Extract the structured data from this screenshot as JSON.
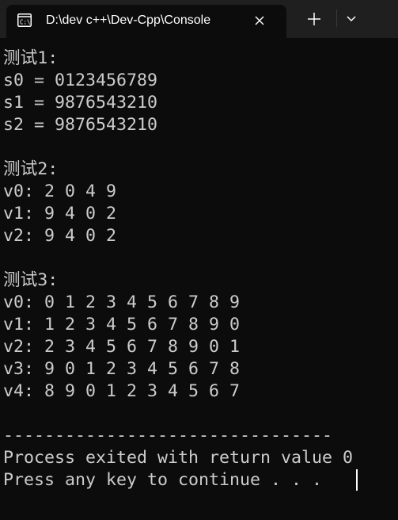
{
  "window": {
    "tab_title": "D:\\dev c++\\Dev-Cpp\\Console",
    "tab_icon": "console-app-icon",
    "close_icon": "close-icon",
    "new_tab_icon": "plus-icon",
    "dropdown_icon": "chevron-down-icon"
  },
  "console": {
    "lines": [
      "测试1:",
      "s0 = 0123456789",
      "s1 = 9876543210",
      "s2 = 9876543210",
      "",
      "测试2:",
      "v0: 2 0 4 9",
      "v1: 9 4 0 2",
      "v2: 9 4 0 2",
      "",
      "测试3:",
      "v0: 0 1 2 3 4 5 6 7 8 9",
      "v1: 1 2 3 4 5 6 7 8 9 0",
      "v2: 2 3 4 5 6 7 8 9 0 1",
      "v3: 9 0 1 2 3 4 5 6 7 8",
      "v4: 8 9 0 1 2 3 4 5 6 7",
      "",
      "--------------------------------",
      "Process exited with return value 0",
      "Press any key to continue . . . "
    ]
  },
  "colors": {
    "background": "#0c0c0c",
    "titlebar": "#1f1f1f",
    "text": "#cccccc",
    "title_text": "#ffffff"
  }
}
